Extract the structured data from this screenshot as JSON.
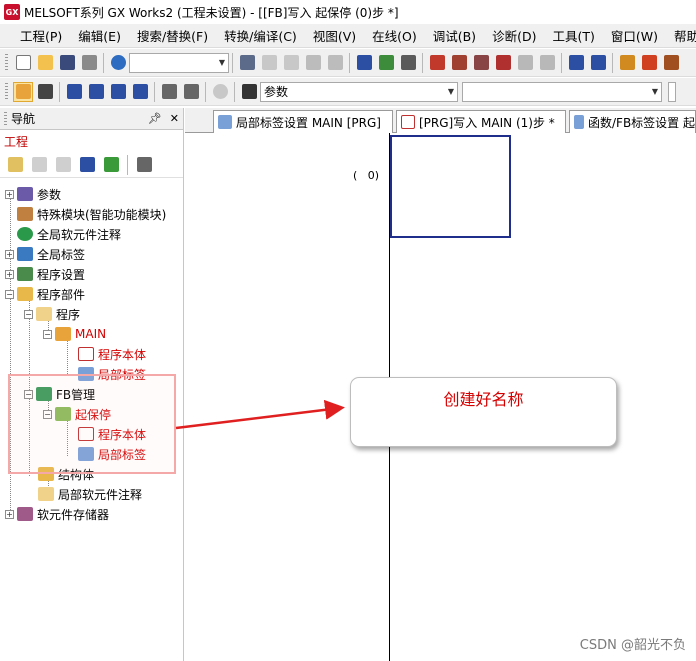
{
  "window": {
    "icon_text": "GX",
    "title": "MELSOFT系列 GX Works2 (工程未设置) - [[FB]写入 起保停 (0)步 *]"
  },
  "menu": {
    "items": [
      "工程(P)",
      "编辑(E)",
      "搜索/替换(F)",
      "转换/编译(C)",
      "视图(V)",
      "在线(O)",
      "调试(B)",
      "诊断(D)",
      "工具(T)",
      "窗口(W)",
      "帮助(H)"
    ]
  },
  "toolbar2": {
    "search_combo_value": "参数"
  },
  "navigator": {
    "title": "导航",
    "pin_icon": "pin-icon",
    "close_icon": "close-icon",
    "project_label": "工程",
    "tree": [
      {
        "label": "参数",
        "color": "#000000"
      },
      {
        "label": "特殊模块(智能功能模块)",
        "color": "#000000"
      },
      {
        "label": "全局软元件注释",
        "color": "#000000"
      },
      {
        "label": "全局标签",
        "color": "#000000"
      },
      {
        "label": "程序设置",
        "color": "#000000"
      },
      {
        "label": "程序部件",
        "color": "#000000"
      },
      {
        "label": "程序",
        "color": "#000000"
      },
      {
        "label": "MAIN",
        "color": "#d40000"
      },
      {
        "label": "程序本体",
        "color": "#d40000"
      },
      {
        "label": "局部标签",
        "color": "#d40000"
      },
      {
        "label": "FB管理",
        "color": "#000000"
      },
      {
        "label": "起保停",
        "color": "#d40000"
      },
      {
        "label": "程序本体",
        "color": "#d40000"
      },
      {
        "label": "局部标签",
        "color": "#d40000"
      },
      {
        "label": "结构体",
        "color": "#000000"
      },
      {
        "label": "局部软元件注释",
        "color": "#000000"
      },
      {
        "label": "软元件存储器",
        "color": "#000000"
      }
    ]
  },
  "tabs": [
    {
      "label": "局部标签设置 MAIN [PRG]"
    },
    {
      "label": "[PRG]写入 MAIN (1)步 *"
    },
    {
      "label": "函数/FB标签设置 起"
    }
  ],
  "editor": {
    "step_open": "(",
    "step_number": "0)"
  },
  "callout": {
    "text": "创建好名称"
  },
  "watermark": "CSDN @韶光不负",
  "colors": {
    "accent_red": "#d40000",
    "cursor_blue": "#1f2e8a",
    "highlight_pink": "#f4a8a8",
    "arrow_red": "#e02020"
  }
}
